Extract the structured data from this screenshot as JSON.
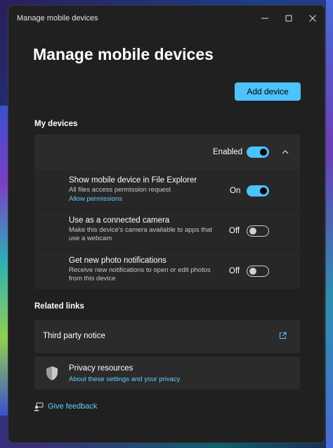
{
  "window": {
    "title": "Manage mobile devices",
    "controls": [
      "minimize",
      "maximize",
      "close"
    ]
  },
  "page": {
    "heading": "Manage mobile devices",
    "add_device_label": "Add device"
  },
  "my_devices": {
    "section_label": "My devices",
    "device_toggle": {
      "label": "Enabled",
      "state": "on"
    },
    "settings": [
      {
        "title": "Show mobile device in File Explorer",
        "description": "All files access permission request",
        "link": "Allow permissions",
        "state_label": "On",
        "state": "on"
      },
      {
        "title": "Use as a connected camera",
        "description": "Make this device's camera available to apps that use a webcam",
        "state_label": "Off",
        "state": "off"
      },
      {
        "title": "Get new photo notifications",
        "description": "Receive new notifications to open or edit photos from this device",
        "state_label": "Off",
        "state": "off"
      }
    ]
  },
  "related_links": {
    "section_label": "Related links",
    "third_party": "Third party notice",
    "privacy": {
      "title": "Privacy resources",
      "link": "About these settings and your privacy"
    }
  },
  "feedback": {
    "label": "Give feedback"
  },
  "colors": {
    "accent": "#4cc2ff",
    "link": "#60cdff",
    "window_bg": "#202020",
    "card_bg": "#2b2b2b"
  },
  "icons": [
    "minimize-icon",
    "maximize-icon",
    "close-icon",
    "chevron-up-icon",
    "external-link-icon",
    "shield-icon",
    "feedback-icon"
  ]
}
